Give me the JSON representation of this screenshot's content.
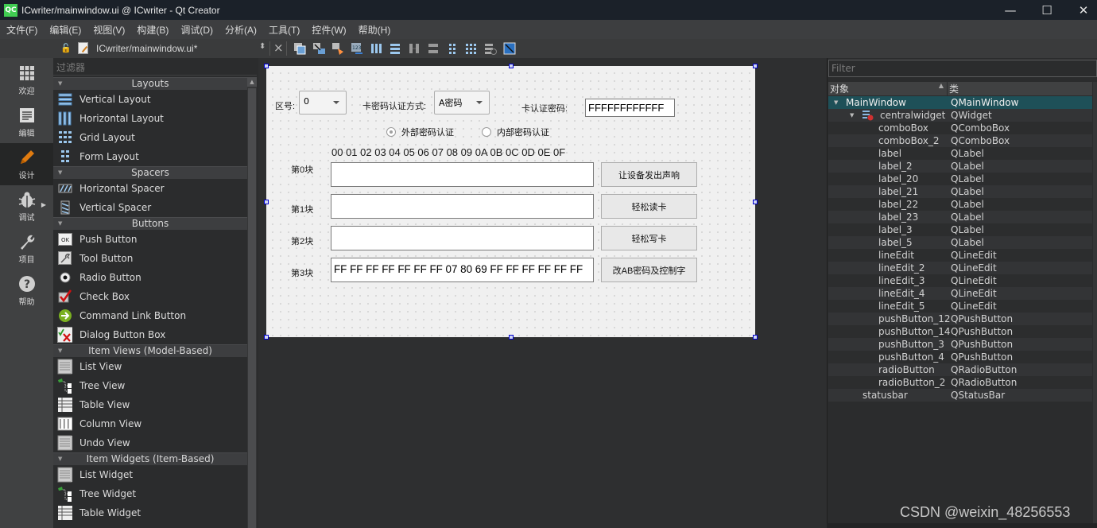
{
  "window": {
    "title": "ICwriter/mainwindow.ui @ ICwriter - Qt Creator",
    "logo_text": "QC",
    "controls": {
      "minimize": "—",
      "maximize": "☐",
      "close": "✕"
    }
  },
  "menubar": {
    "items": [
      "文件(F)",
      "编辑(E)",
      "视图(V)",
      "构建(B)",
      "调试(D)",
      "分析(A)",
      "工具(T)",
      "控件(W)",
      "帮助(H)"
    ]
  },
  "modebar": {
    "items": [
      {
        "label": "欢迎",
        "icon": "grid-icon",
        "active": false
      },
      {
        "label": "编辑",
        "icon": "document-icon",
        "active": false
      },
      {
        "label": "设计",
        "icon": "pencil-icon",
        "active": true
      },
      {
        "label": "调试",
        "icon": "bug-icon",
        "active": false
      },
      {
        "label": "项目",
        "icon": "wrench-icon",
        "active": false
      },
      {
        "label": "帮助",
        "icon": "help-icon",
        "active": false
      }
    ]
  },
  "editor": {
    "file_name": "ICwriter/mainwindow.ui*",
    "toolbar_icons": [
      "edit-widgets-icon",
      "edit-signals-slots-icon",
      "edit-buddies-icon",
      "edit-tab-order-icon",
      "layout-horizontal-icon",
      "layout-vertical-icon",
      "layout-h-splitter-icon",
      "layout-v-splitter-icon",
      "layout-form-icon",
      "layout-grid-icon",
      "break-layout-icon",
      "adjust-size-icon"
    ]
  },
  "widgetbox": {
    "filter_placeholder": "过滤器",
    "categories": [
      {
        "name": "Layouts",
        "items": [
          "Vertical Layout",
          "Horizontal Layout",
          "Grid Layout",
          "Form Layout"
        ]
      },
      {
        "name": "Spacers",
        "items": [
          "Horizontal Spacer",
          "Vertical Spacer"
        ]
      },
      {
        "name": "Buttons",
        "items": [
          "Push Button",
          "Tool Button",
          "Radio Button",
          "Check Box",
          "Command Link Button",
          "Dialog Button Box"
        ]
      },
      {
        "name": "Item Views (Model-Based)",
        "items": [
          "List View",
          "Tree View",
          "Table View",
          "Column View",
          "Undo View"
        ]
      },
      {
        "name": "Item Widgets (Item-Based)",
        "items": [
          "List Widget",
          "Tree Widget",
          "Table Widget"
        ]
      }
    ]
  },
  "form": {
    "sector_label": "区号:",
    "sector_value": "0",
    "auth_mode_label": "卡密码认证方式:",
    "auth_mode_value": "A密码",
    "card_password_label": "卡认证密码:",
    "card_password_value": "FFFFFFFFFFFF",
    "radio_external": {
      "label": "外部密码认证",
      "checked": true
    },
    "radio_internal": {
      "label": "内部密码认证",
      "checked": false
    },
    "hex_header": "00 01 02 03 04 05 06 07 08 09 0A 0B 0C 0D 0E 0F",
    "blocks": [
      {
        "label": "第0块",
        "value": "",
        "button": "让设备发出声响"
      },
      {
        "label": "第1块",
        "value": "",
        "button": "轻松读卡"
      },
      {
        "label": "第2块",
        "value": "",
        "button": "轻松写卡"
      },
      {
        "label": "第3块",
        "value": "FF FF FF FF FF FF FF 07 80 69 FF FF FF FF FF FF",
        "button": "改AB密码及控制字"
      }
    ]
  },
  "inspector": {
    "filter_placeholder": "Filter",
    "col_object": "对象",
    "col_class": "类",
    "rows": [
      {
        "object": "MainWindow",
        "class": "QMainWindow",
        "level": 0,
        "expanded": true,
        "selected": true
      },
      {
        "object": "centralwidget",
        "class": "QWidget",
        "level": 1,
        "expanded": true,
        "selected": false
      },
      {
        "object": "comboBox",
        "class": "QComboBox",
        "level": 2
      },
      {
        "object": "comboBox_2",
        "class": "QComboBox",
        "level": 2
      },
      {
        "object": "label",
        "class": "QLabel",
        "level": 2
      },
      {
        "object": "label_2",
        "class": "QLabel",
        "level": 2
      },
      {
        "object": "label_20",
        "class": "QLabel",
        "level": 2
      },
      {
        "object": "label_21",
        "class": "QLabel",
        "level": 2
      },
      {
        "object": "label_22",
        "class": "QLabel",
        "level": 2
      },
      {
        "object": "label_23",
        "class": "QLabel",
        "level": 2
      },
      {
        "object": "label_3",
        "class": "QLabel",
        "level": 2
      },
      {
        "object": "label_5",
        "class": "QLabel",
        "level": 2
      },
      {
        "object": "lineEdit",
        "class": "QLineEdit",
        "level": 2
      },
      {
        "object": "lineEdit_2",
        "class": "QLineEdit",
        "level": 2
      },
      {
        "object": "lineEdit_3",
        "class": "QLineEdit",
        "level": 2
      },
      {
        "object": "lineEdit_4",
        "class": "QLineEdit",
        "level": 2
      },
      {
        "object": "lineEdit_5",
        "class": "QLineEdit",
        "level": 2
      },
      {
        "object": "pushButton_12",
        "class": "QPushButton",
        "level": 2
      },
      {
        "object": "pushButton_14",
        "class": "QPushButton",
        "level": 2
      },
      {
        "object": "pushButton_3",
        "class": "QPushButton",
        "level": 2
      },
      {
        "object": "pushButton_4",
        "class": "QPushButton",
        "level": 2
      },
      {
        "object": "radioButton",
        "class": "QRadioButton",
        "level": 2
      },
      {
        "object": "radioButton_2",
        "class": "QRadioButton",
        "level": 2
      },
      {
        "object": "statusbar",
        "class": "QStatusBar",
        "level": 1
      }
    ]
  },
  "watermark": "CSDN @weixin_48256553",
  "colors": {
    "accent_selected_row": "#1e5058",
    "design_mode_pencil": "#e07b10",
    "handle_border": "#0000d0"
  }
}
